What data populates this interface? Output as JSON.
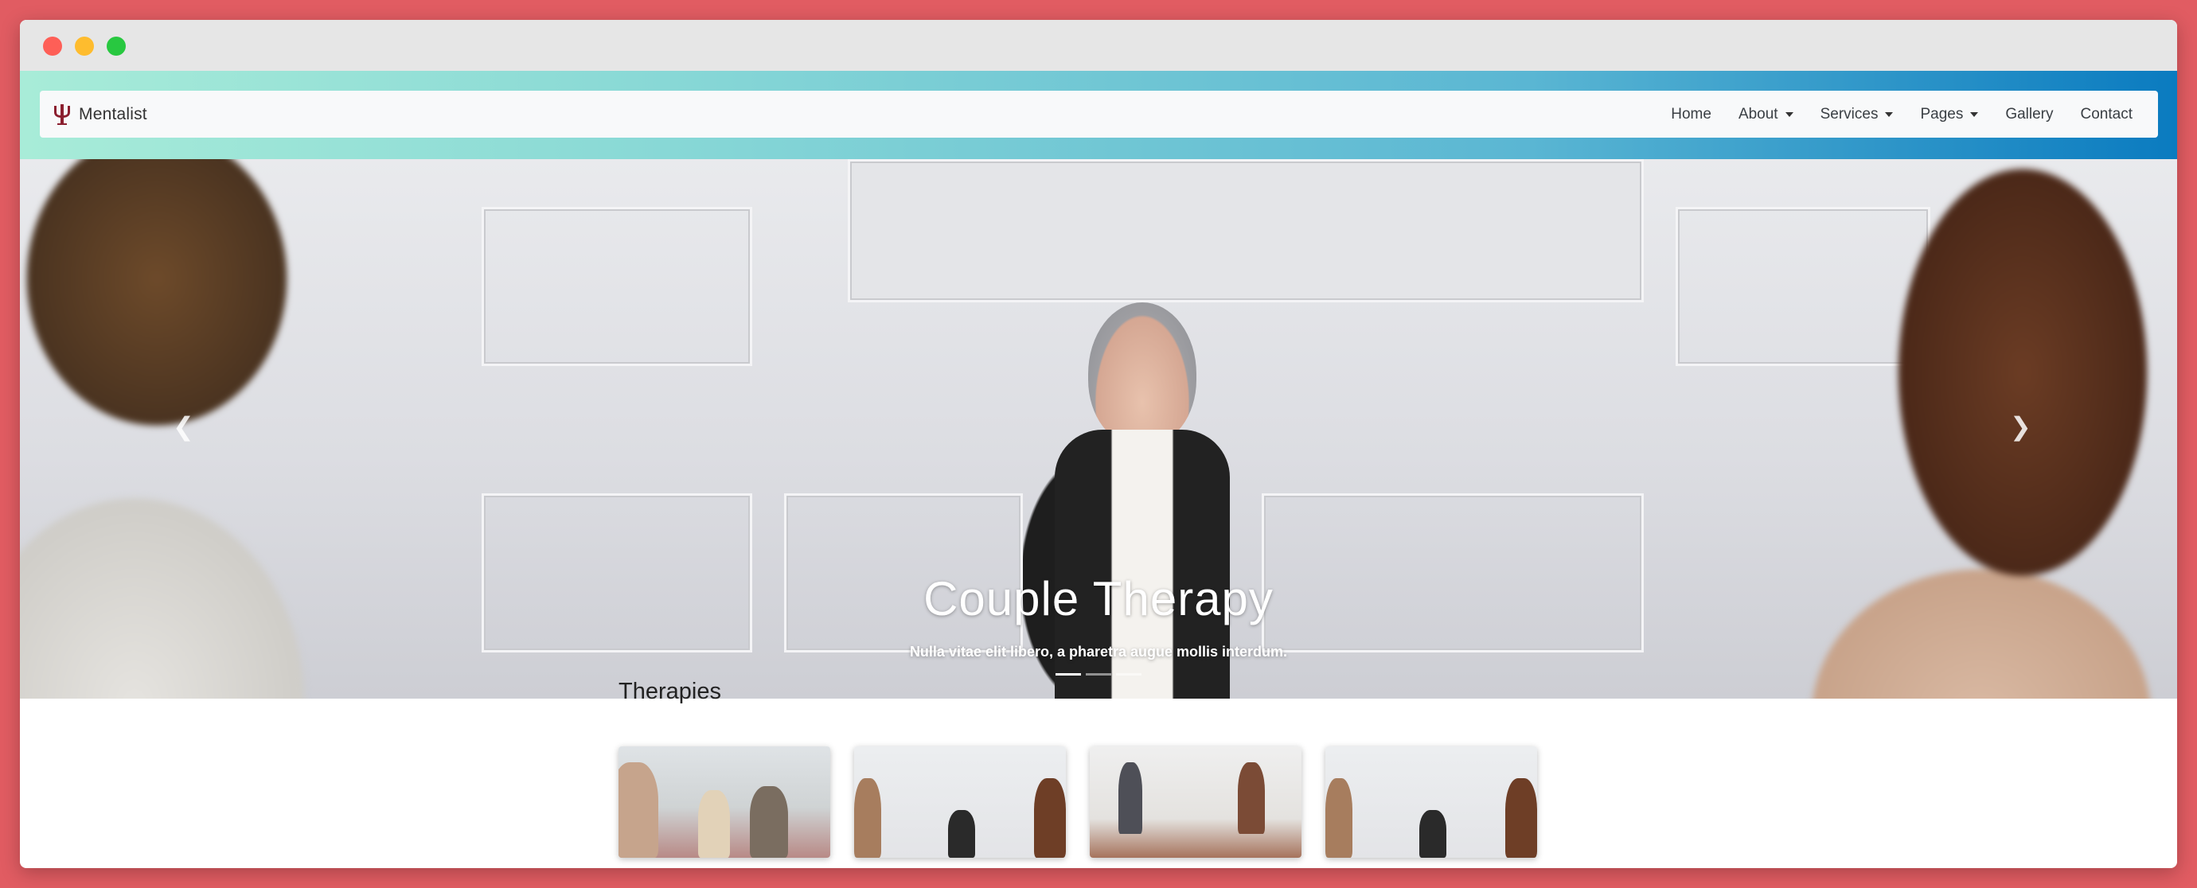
{
  "window": {
    "controls": [
      "close",
      "minimize",
      "maximize"
    ]
  },
  "navbar": {
    "brand": {
      "icon": "psi-icon",
      "name": "Mentalist"
    },
    "items": [
      {
        "label": "Home",
        "dropdown": false
      },
      {
        "label": "About",
        "dropdown": true
      },
      {
        "label": "Services",
        "dropdown": true
      },
      {
        "label": "Pages",
        "dropdown": true
      },
      {
        "label": "Gallery",
        "dropdown": false
      },
      {
        "label": "Contact",
        "dropdown": false
      }
    ]
  },
  "hero": {
    "title": "Couple Therapy",
    "text": "Nulla vitae elit libero, a pharetra augue mollis interdum.",
    "prev_icon": "chevron-left-icon",
    "next_icon": "chevron-right-icon",
    "slides": 3,
    "active_slide": 1
  },
  "therapies": {
    "title": "Therapies",
    "cards": 4
  },
  "colors": {
    "background": "#e15c62",
    "brand_icon": "#8b1f2f",
    "gradient_start": "#a8ecd8",
    "gradient_end": "#0a7bc0"
  }
}
